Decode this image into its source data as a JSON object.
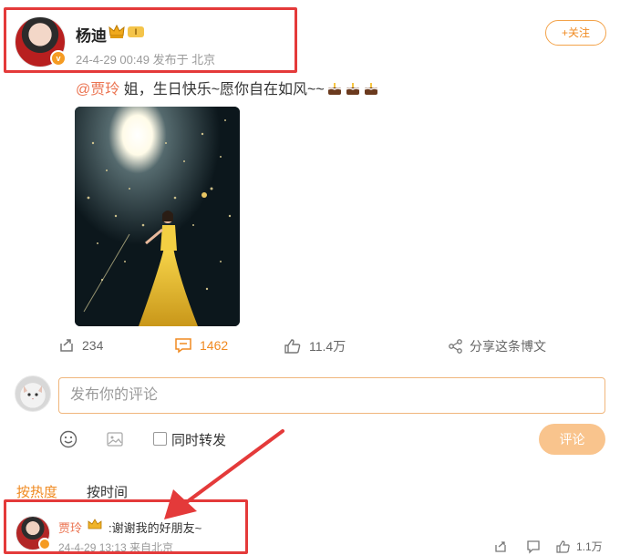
{
  "post": {
    "author": "杨迪",
    "level_badge": "I",
    "meta": "24-4-29 00:49 发布于 北京",
    "follow_label": "+关注",
    "mention": "@贾玲",
    "text": " 姐，生日快乐~愿你自在如风~~"
  },
  "actions": {
    "repost_count": "234",
    "comment_count": "1462",
    "like_count": "11.4万",
    "share_label": "分享这条博文"
  },
  "composer": {
    "placeholder": "发布你的评论",
    "repost_label": "同时转发",
    "submit_label": "评论"
  },
  "sort_tabs": {
    "hot": "按热度",
    "time": "按时间"
  },
  "comment": {
    "author": "贾玲",
    "text": ":谢谢我的好朋友~",
    "meta": "24-4-29 13:13 来自北京",
    "like_count": "1.1万"
  },
  "colors": {
    "accent": "#f08a21",
    "highlight_box": "#e43a3a",
    "mention": "#eb7350",
    "submit_disabled": "#f9c48d"
  }
}
